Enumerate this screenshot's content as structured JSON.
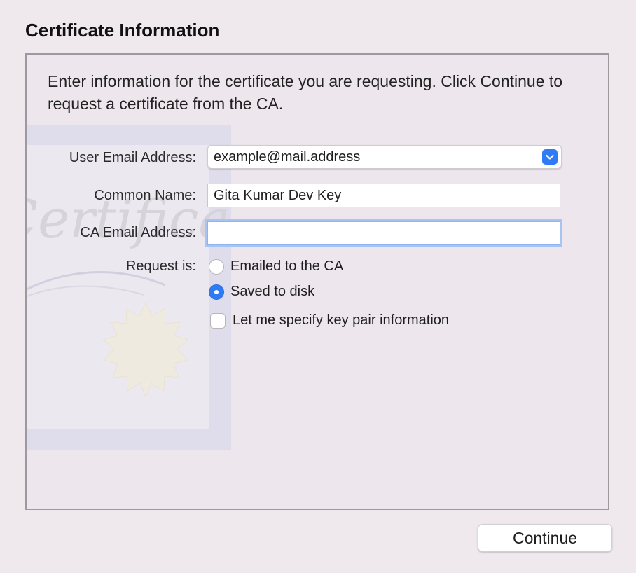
{
  "title": "Certificate Information",
  "intro": "Enter information for the certificate you are requesting. Click Continue to request a certificate from the CA.",
  "form": {
    "user_email_label": "User Email Address:",
    "user_email_value": "example@mail.address",
    "common_name_label": "Common Name:",
    "common_name_value": "Gita Kumar Dev Key",
    "ca_email_label": "CA Email Address:",
    "ca_email_value": "",
    "request_label": "Request is:",
    "options": [
      {
        "label": "Emailed to the CA",
        "selected": false
      },
      {
        "label": "Saved to disk",
        "selected": true
      }
    ],
    "key_pair_label": "Let me specify key pair information",
    "key_pair_checked": false
  },
  "buttons": {
    "continue": "Continue"
  },
  "background_art_text": "Certificate",
  "colors": {
    "accent": "#2f7bf5",
    "focus_ring": "#a8c4f3",
    "window_bg": "#efe9ee"
  }
}
